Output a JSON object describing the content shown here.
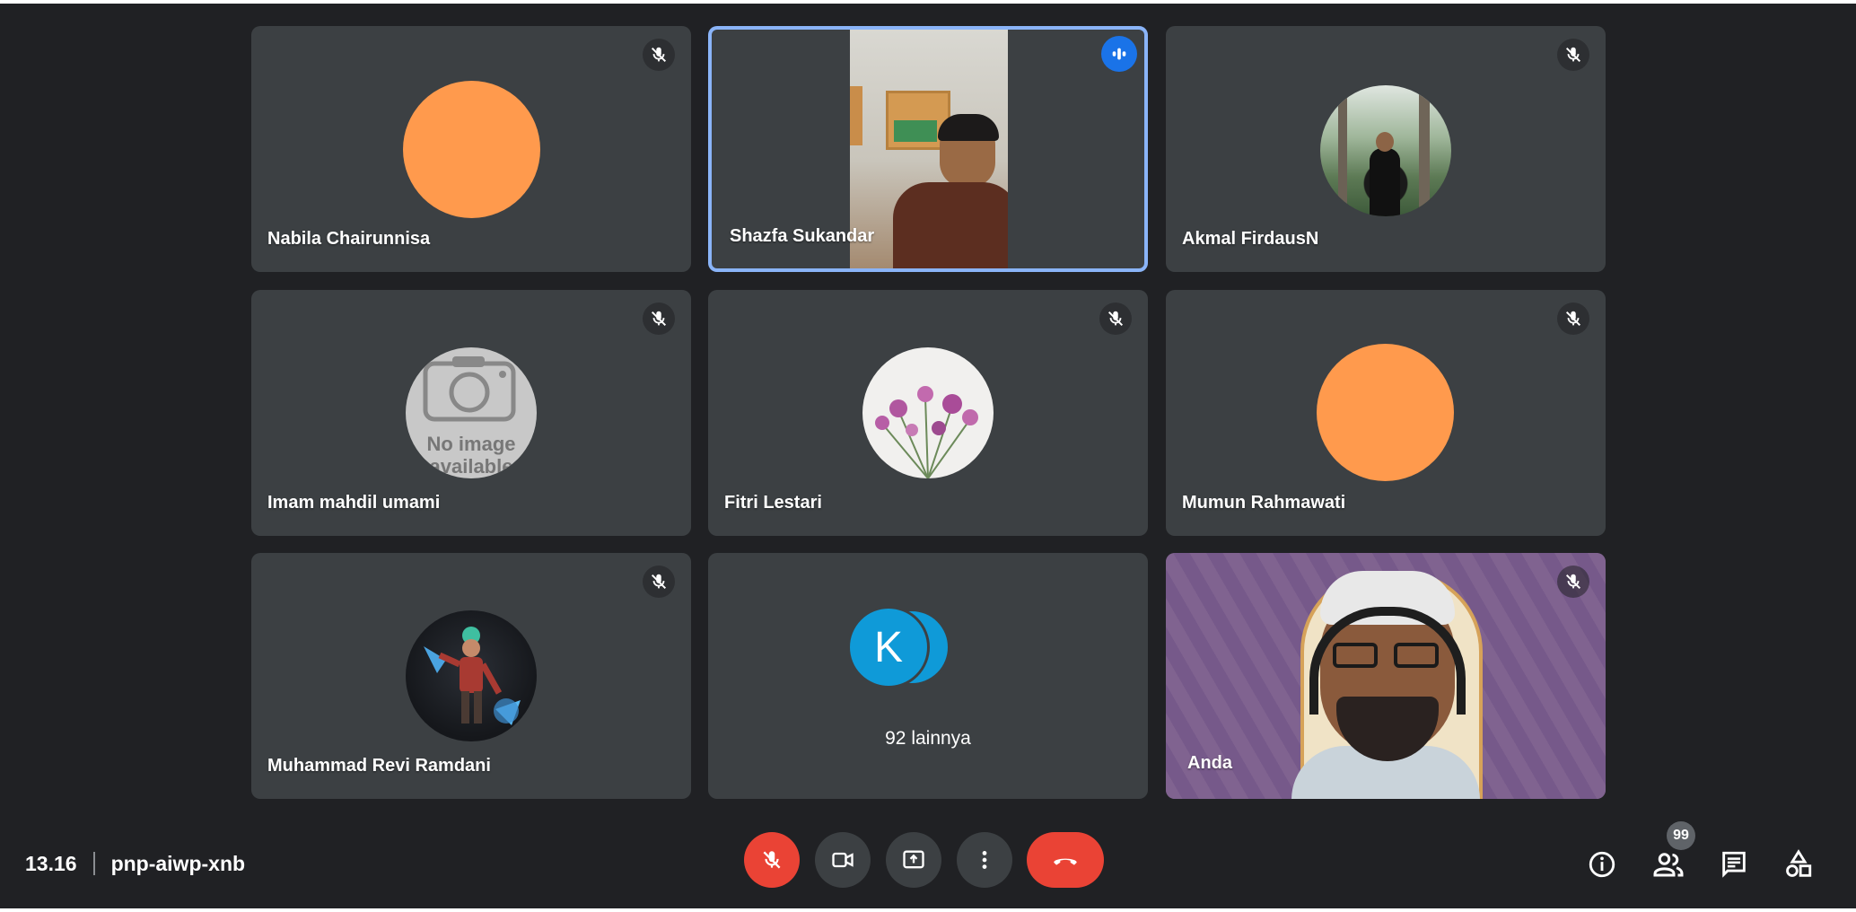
{
  "participants": [
    {
      "name": "Nabila Chairunnisa",
      "avatar": "orange-circle-avatar",
      "muted": true
    },
    {
      "name": "Shazfa Sukandar",
      "avatar": "camera-video",
      "speaking": true
    },
    {
      "name": "Akmal FirdausN",
      "avatar": "forest-photo-avatar",
      "muted": true
    },
    {
      "name": "Imam mahdil umami",
      "avatar": "no-image-placeholder",
      "avatar_text_line1": "No image",
      "avatar_text_line2": "available",
      "muted": true
    },
    {
      "name": "Fitri Lestari",
      "avatar": "flowers-photo-avatar",
      "muted": true
    },
    {
      "name": "Mumun Rahmawati",
      "avatar": "orange-circle-avatar",
      "muted": true
    },
    {
      "name": "Muhammad Revi Ramdani",
      "avatar": "game-character-avatar",
      "muted": true
    }
  ],
  "others_tile": {
    "initial": "K",
    "label": "92 lainnya"
  },
  "self_tile": {
    "name": "Anda",
    "muted": true
  },
  "bottom_bar": {
    "time": "13.16",
    "meeting_code": "pnp-aiwp-xnb",
    "people_count": "99"
  },
  "colors": {
    "background": "#202124",
    "tile": "#3c4043",
    "active_border": "#8ab4f8",
    "danger": "#ea4335",
    "control": "#3c4043",
    "avatar_orange": "#ff9a4d",
    "avatar_blue": "#0f9ad8",
    "self_bg": "#7b5f8a"
  }
}
